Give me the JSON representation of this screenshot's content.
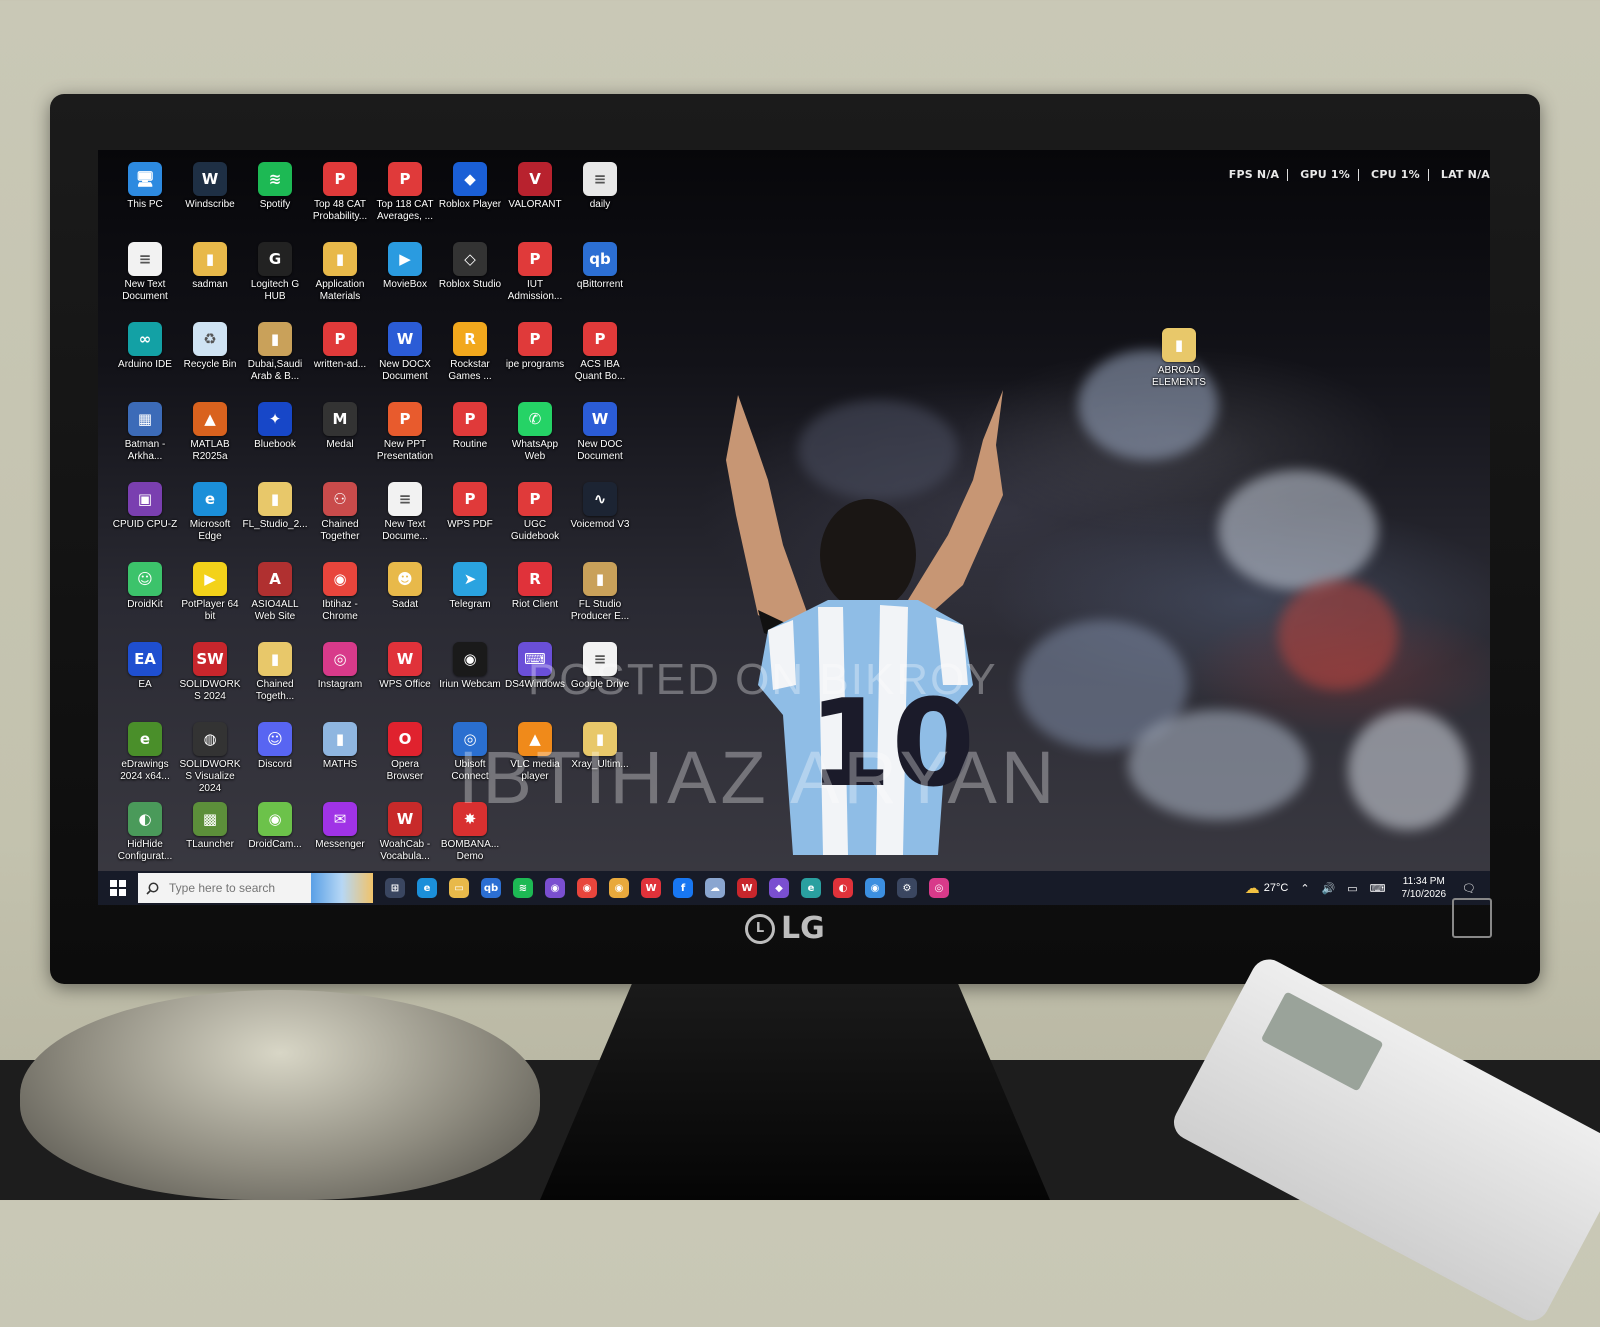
{
  "desktop": {
    "icons": [
      {
        "label": "This PC",
        "icon": "computer-icon",
        "color": "#2d8ae0",
        "glyph": "🖥"
      },
      {
        "label": "Windscribe",
        "icon": "windscribe-icon",
        "color": "#1e2f44",
        "glyph": "W"
      },
      {
        "label": "Spotify",
        "icon": "spotify-icon",
        "color": "#1db954",
        "glyph": "≋"
      },
      {
        "label": "Top 48 CAT Probability...",
        "icon": "wps-pdf-icon",
        "color": "#e03a3a",
        "glyph": "P"
      },
      {
        "label": "Top 118 CAT Averages, ...",
        "icon": "wps-pdf-icon",
        "color": "#e03a3a",
        "glyph": "P"
      },
      {
        "label": "Roblox Player",
        "icon": "roblox-icon",
        "color": "#1a5fd6",
        "glyph": "◆"
      },
      {
        "label": "VALORANT",
        "icon": "valorant-icon",
        "color": "#b8222e",
        "glyph": "V"
      },
      {
        "label": "daily",
        "icon": "text-document-icon",
        "color": "#e8e8e8",
        "glyph": "≡"
      },
      {
        "label": "New Text Document",
        "icon": "text-document-icon",
        "color": "#f2f2f2",
        "glyph": "≡"
      },
      {
        "label": "sadman",
        "icon": "folder-icon",
        "color": "#e8b94a",
        "glyph": "▮"
      },
      {
        "label": "Logitech G HUB",
        "icon": "logitech-icon",
        "color": "#222222",
        "glyph": "G"
      },
      {
        "label": "Application Materials",
        "icon": "folder-icon",
        "color": "#e8b94a",
        "glyph": "▮"
      },
      {
        "label": "MovieBox",
        "icon": "moviebox-icon",
        "color": "#2a9be0",
        "glyph": "▶"
      },
      {
        "label": "Roblox Studio",
        "icon": "roblox-studio-icon",
        "color": "#333333",
        "glyph": "◇"
      },
      {
        "label": "IUT Admission...",
        "icon": "wps-pdf-icon",
        "color": "#e03a3a",
        "glyph": "P"
      },
      {
        "label": "qBittorrent",
        "icon": "qbittorrent-icon",
        "color": "#2c6fd3",
        "glyph": "qb"
      },
      {
        "label": "Arduino IDE",
        "icon": "arduino-icon",
        "color": "#13a1a5",
        "glyph": "∞"
      },
      {
        "label": "Recycle Bin",
        "icon": "recycle-bin-icon",
        "color": "#cfe3f3",
        "glyph": "♻"
      },
      {
        "label": "Dubai,Saudi Arab & B...",
        "icon": "folder-icon",
        "color": "#c9a15a",
        "glyph": "▮"
      },
      {
        "label": "written-ad...",
        "icon": "wps-pdf-icon",
        "color": "#e03a3a",
        "glyph": "P"
      },
      {
        "label": "New DOCX Document",
        "icon": "word-document-icon",
        "color": "#2b5cd6",
        "glyph": "W"
      },
      {
        "label": "Rockstar Games ...",
        "icon": "rockstar-icon",
        "color": "#f2a81d",
        "glyph": "R"
      },
      {
        "label": "ipe programs",
        "icon": "wps-pdf-icon",
        "color": "#e03a3a",
        "glyph": "P"
      },
      {
        "label": "ACS IBA Quant Bo...",
        "icon": "wps-pdf-icon",
        "color": "#e03a3a",
        "glyph": "P"
      },
      {
        "label": "Batman - Arkha...",
        "icon": "game-shortcut-icon",
        "color": "#3c6bb8",
        "glyph": "▦"
      },
      {
        "label": "MATLAB R2025a",
        "icon": "matlab-icon",
        "color": "#d9621e",
        "glyph": "▲"
      },
      {
        "label": "Bluebook",
        "icon": "bluebook-icon",
        "color": "#1747c8",
        "glyph": "✦"
      },
      {
        "label": "Medal",
        "icon": "medal-icon",
        "color": "#333333",
        "glyph": "M"
      },
      {
        "label": "New PPT Presentation",
        "icon": "ppt-document-icon",
        "color": "#e85b2d",
        "glyph": "P"
      },
      {
        "label": "Routine",
        "icon": "wps-pdf-icon",
        "color": "#e03a3a",
        "glyph": "P"
      },
      {
        "label": "WhatsApp Web",
        "icon": "whatsapp-icon",
        "color": "#25d366",
        "glyph": "✆"
      },
      {
        "label": "New DOC Document",
        "icon": "word-document-icon",
        "color": "#2b5cd6",
        "glyph": "W"
      },
      {
        "label": "CPUID CPU-Z",
        "icon": "cpuz-icon",
        "color": "#7a3fb0",
        "glyph": "▣"
      },
      {
        "label": "Microsoft Edge",
        "icon": "edge-icon",
        "color": "#1b8fd9",
        "glyph": "e"
      },
      {
        "label": "FL_Studio_2...",
        "icon": "folder-icon",
        "color": "#e8c86a",
        "glyph": "▮"
      },
      {
        "label": "Chained Together",
        "icon": "chained-together-icon",
        "color": "#c94b4b",
        "glyph": "⚇"
      },
      {
        "label": "New Text Docume...",
        "icon": "text-document-icon",
        "color": "#f2f2f2",
        "glyph": "≡"
      },
      {
        "label": "WPS PDF",
        "icon": "wps-pdf-icon",
        "color": "#e03a3a",
        "glyph": "P"
      },
      {
        "label": "UGC Guidebook",
        "icon": "wps-pdf-icon",
        "color": "#e03a3a",
        "glyph": "P"
      },
      {
        "label": "Voicemod V3",
        "icon": "voicemod-icon",
        "color": "#1c2433",
        "glyph": "∿"
      },
      {
        "label": "DroidKit",
        "icon": "droidkit-icon",
        "color": "#3cc36b",
        "glyph": "☺"
      },
      {
        "label": "PotPlayer 64 bit",
        "icon": "potplayer-icon",
        "color": "#f3d21a",
        "glyph": "▶"
      },
      {
        "label": "ASIO4ALL Web Site",
        "icon": "asio4all-icon",
        "color": "#b03030",
        "glyph": "A"
      },
      {
        "label": "Ibtihaz - Chrome",
        "icon": "chrome-icon",
        "color": "#e8453c",
        "glyph": "◉"
      },
      {
        "label": "Sadat",
        "icon": "user-folder-icon",
        "color": "#e8b94a",
        "glyph": "☻"
      },
      {
        "label": "Telegram",
        "icon": "telegram-icon",
        "color": "#2aa3e0",
        "glyph": "➤"
      },
      {
        "label": "Riot Client",
        "icon": "riot-client-icon",
        "color": "#e0323a",
        "glyph": "R"
      },
      {
        "label": "FL Studio Producer E...",
        "icon": "folder-icon",
        "color": "#c9a15a",
        "glyph": "▮"
      },
      {
        "label": "EA",
        "icon": "ea-icon",
        "color": "#1f4fd0",
        "glyph": "EA"
      },
      {
        "label": "SOLIDWORKS 2024",
        "icon": "solidworks-icon",
        "color": "#c8262c",
        "glyph": "SW"
      },
      {
        "label": "Chained Togeth...",
        "icon": "folder-icon",
        "color": "#e8c86a",
        "glyph": "▮"
      },
      {
        "label": "Instagram",
        "icon": "instagram-icon",
        "color": "#d83a8a",
        "glyph": "◎"
      },
      {
        "label": "WPS Office",
        "icon": "wps-office-icon",
        "color": "#e0323a",
        "glyph": "W"
      },
      {
        "label": "Iriun Webcam",
        "icon": "iriun-webcam-icon",
        "color": "#1a1a1a",
        "glyph": "◉"
      },
      {
        "label": "DS4Windows",
        "icon": "ds4windows-icon",
        "color": "#6a4fd8",
        "glyph": "⌨"
      },
      {
        "label": "Google Drive",
        "icon": "text-document-icon",
        "color": "#f2f2f2",
        "glyph": "≡"
      },
      {
        "label": "eDrawings 2024 x64...",
        "icon": "edrawings-icon",
        "color": "#4a8f2a",
        "glyph": "e"
      },
      {
        "label": "SOLIDWORKS Visualize 2024",
        "icon": "solidworks-visualize-icon",
        "color": "#333333",
        "glyph": "◍"
      },
      {
        "label": "Discord",
        "icon": "discord-icon",
        "color": "#5865f2",
        "glyph": "☺"
      },
      {
        "label": "MATHS",
        "icon": "folder-icon",
        "color": "#8fb6e0",
        "glyph": "▮"
      },
      {
        "label": "Opera Browser",
        "icon": "opera-icon",
        "color": "#e0222e",
        "glyph": "O"
      },
      {
        "label": "Ubisoft Connect",
        "icon": "ubisoft-icon",
        "color": "#2a6fd0",
        "glyph": "◎"
      },
      {
        "label": "VLC media player",
        "icon": "vlc-icon",
        "color": "#f08a1a",
        "glyph": "▲"
      },
      {
        "label": "Xray_Ultim...",
        "icon": "folder-icon",
        "color": "#e8c86a",
        "glyph": "▮"
      },
      {
        "label": "HidHide Configurat...",
        "icon": "hidhide-icon",
        "color": "#4a9a5a",
        "glyph": "◐"
      },
      {
        "label": "TLauncher",
        "icon": "tlauncher-icon",
        "color": "#5c8f3a",
        "glyph": "▩"
      },
      {
        "label": "DroidCam...",
        "icon": "droidcam-icon",
        "color": "#6cc24a",
        "glyph": "◉"
      },
      {
        "label": "Messenger",
        "icon": "messenger-icon",
        "color": "#a033e6",
        "glyph": "✉"
      },
      {
        "label": "WoahCab - Vocabula...",
        "icon": "woahcab-icon",
        "color": "#c82a2a",
        "glyph": "W"
      },
      {
        "label": "BOMBANA... Demo",
        "icon": "bombana-icon",
        "color": "#d83030",
        "glyph": "✸"
      }
    ],
    "extra_icon": {
      "label": "ABROAD ELEMENTS",
      "icon": "zip-folder-icon",
      "color": "#e8c86a",
      "glyph": "▮"
    }
  },
  "overlay": {
    "fps": "FPS N/A",
    "gpu": "GPU 1%",
    "cpu": "CPU 1%",
    "lat": "LAT N/A"
  },
  "watermark": {
    "line1": "POSTED ON BIKROY",
    "line2": "IBTIHAZ ARYAN"
  },
  "taskbar": {
    "search_placeholder": "Type here to search",
    "apps": [
      {
        "icon": "task-view-icon",
        "color": "#3a4660",
        "glyph": "⊞"
      },
      {
        "icon": "edge-icon",
        "color": "#1b8fd9",
        "glyph": "e"
      },
      {
        "icon": "file-explorer-icon",
        "color": "#e8b94a",
        "glyph": "▭"
      },
      {
        "icon": "qbittorrent-icon",
        "color": "#2c6fd3",
        "glyph": "qb"
      },
      {
        "icon": "spotify-icon",
        "color": "#1db954",
        "glyph": "≋"
      },
      {
        "icon": "chrome-icon",
        "color": "#7a4fd0",
        "glyph": "◉"
      },
      {
        "icon": "chrome-icon",
        "color": "#e8453c",
        "glyph": "◉"
      },
      {
        "icon": "chrome-icon",
        "color": "#e8a93c",
        "glyph": "◉"
      },
      {
        "icon": "wps-office-icon",
        "color": "#e0323a",
        "glyph": "W"
      },
      {
        "icon": "facebook-icon",
        "color": "#1877f2",
        "glyph": "f"
      },
      {
        "icon": "photo-viewer-icon",
        "color": "#8aa6d0",
        "glyph": "☁"
      },
      {
        "icon": "wps-writer-icon",
        "color": "#c8262c",
        "glyph": "W"
      },
      {
        "icon": "drop-icon",
        "color": "#7a4fd0",
        "glyph": "◆"
      },
      {
        "icon": "edge-dev-icon",
        "color": "#2aa0a0",
        "glyph": "e"
      },
      {
        "icon": "wps-office-icon",
        "color": "#e0323a",
        "glyph": "◐"
      },
      {
        "icon": "chrome-icon",
        "color": "#3c8fe0",
        "glyph": "◉"
      },
      {
        "icon": "settings-gear-icon",
        "color": "#3a4660",
        "glyph": "⚙"
      },
      {
        "icon": "instagram-icon",
        "color": "#d83a8a",
        "glyph": "◎"
      }
    ],
    "weather": "27°C",
    "time": "11:34 PM",
    "date": "7/10/2026"
  },
  "monitor": {
    "brand": "LG"
  }
}
